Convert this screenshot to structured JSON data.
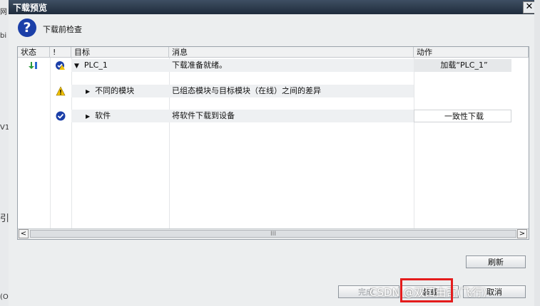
{
  "dialog": {
    "title": "下载预览",
    "close_glyph": "✕",
    "subtitle": "下载前检查"
  },
  "background": {
    "left_fragments": [
      "⽹",
      "bi",
      "V1",
      "引",
      "(O"
    ]
  },
  "table": {
    "headers": [
      "状态",
      "!",
      "目标",
      "消息",
      "动作"
    ],
    "rows": [
      {
        "state_icon": "download-arrow-icon",
        "flag_icon": "check-warning-icon",
        "expander": "▼",
        "target": "PLC_1",
        "message": "下载准备就绪。",
        "action": "加载“PLC_1”"
      },
      {
        "state_icon": "",
        "flag_icon": "warning-icon",
        "expander": "▶",
        "target": "不同的模块",
        "message": "已组态模块与目标模块（在线）之间的差异",
        "action": ""
      },
      {
        "state_icon": "",
        "flag_icon": "check-icon",
        "expander": "▶",
        "target": "软件",
        "message": "将软件下载到设备",
        "action": "一致性下载"
      }
    ],
    "scroll_left": "<",
    "scroll_right": ">",
    "scroll_thumb": "III"
  },
  "buttons": {
    "refresh": "刷新",
    "finish_partial": "完成",
    "load": "装载",
    "cancel": "取消"
  },
  "watermark": "CSDN @双口由奇(飞行)",
  "colors": {
    "titlebar": "#2b3a4d",
    "warning": "#f2c200",
    "check": "#1b3fa8",
    "highlight": "#e41c1c"
  }
}
